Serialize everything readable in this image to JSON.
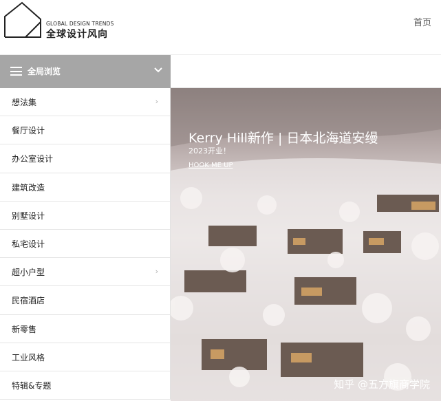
{
  "header": {
    "logo_en": "GLOBAL DESIGN TRENDS",
    "logo_cn": "全球设计风向",
    "home_label": "首页"
  },
  "dropdown": {
    "label": "全局浏览",
    "menu_icon": "hamburger-icon",
    "toggle_icon": "chevron-down-icon"
  },
  "menu": {
    "items": [
      {
        "label": "想法集",
        "arrow": "›"
      },
      {
        "label": "餐厅设计"
      },
      {
        "label": "办公室设计"
      },
      {
        "label": "建筑改造"
      },
      {
        "label": "别墅设计"
      },
      {
        "label": "私宅设计"
      },
      {
        "label": "超小户型",
        "arrow": "›"
      },
      {
        "label": "民宿酒店"
      },
      {
        "label": "新零售"
      },
      {
        "label": "工业风格"
      },
      {
        "label": "特辑&专题"
      }
    ]
  },
  "hero": {
    "title": "Kerry Hill新作 | 日本北海道安缦",
    "subtitle": "2023开业！",
    "link": "HOOK ME UP",
    "watermark": "知乎 @五方旗商学院"
  },
  "colors": {
    "dropdown_bg": "#a6a6a6",
    "text_dark": "#222222",
    "divider": "#e5e5e5"
  }
}
